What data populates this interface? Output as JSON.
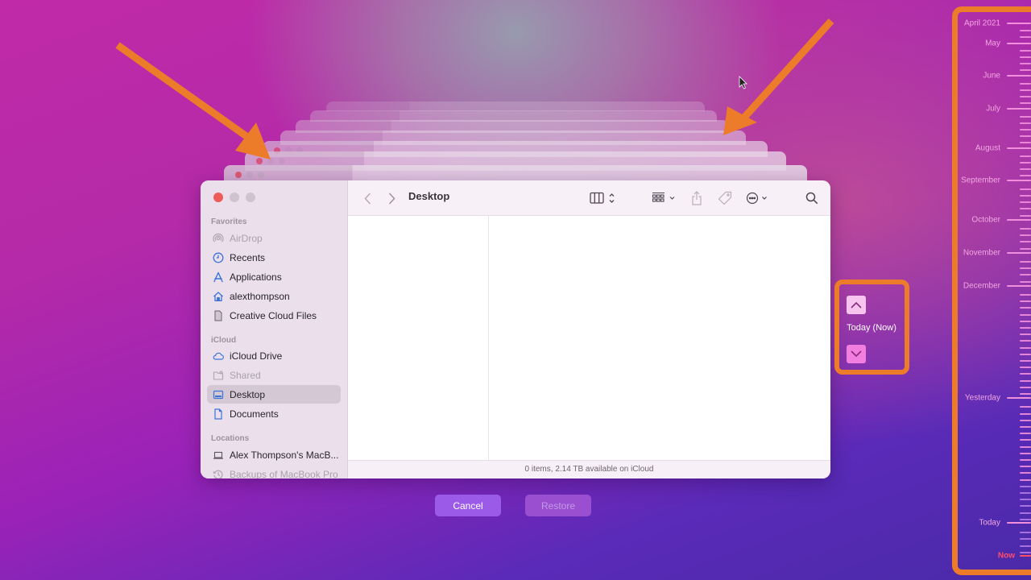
{
  "finder": {
    "title": "Desktop",
    "sidebar": {
      "sections": [
        {
          "label": "Favorites",
          "items": [
            {
              "label": "AirDrop",
              "icon": "airdrop-icon",
              "dim": true
            },
            {
              "label": "Recents",
              "icon": "clock-icon"
            },
            {
              "label": "Applications",
              "icon": "applications-icon"
            },
            {
              "label": "alexthompson",
              "icon": "home-icon"
            },
            {
              "label": "Creative Cloud Files",
              "icon": "document-icon"
            }
          ]
        },
        {
          "label": "iCloud",
          "items": [
            {
              "label": "iCloud Drive",
              "icon": "cloud-icon"
            },
            {
              "label": "Shared",
              "icon": "shared-folder-icon",
              "dim": true
            },
            {
              "label": "Desktop",
              "icon": "desktop-icon",
              "selected": true
            },
            {
              "label": "Documents",
              "icon": "document-icon"
            }
          ]
        },
        {
          "label": "Locations",
          "items": [
            {
              "label": "Alex Thompson's MacB...",
              "icon": "laptop-icon"
            },
            {
              "label": "Backups of MacBook Pro",
              "icon": "time-machine-icon",
              "dim": true
            }
          ]
        }
      ]
    },
    "toolbar": {
      "back": "back-icon",
      "forward": "forward-icon",
      "view": "column-view-icon",
      "group": "group-icon",
      "share": "share-icon",
      "tag": "tag-icon",
      "more": "more-icon",
      "search": "search-icon"
    },
    "status": "0 items, 2.14 TB available on iCloud"
  },
  "buttons": {
    "cancel": "Cancel",
    "restore": "Restore"
  },
  "navigator": {
    "label": "Today (Now)",
    "up": "chevron-up-icon",
    "down": "chevron-down-icon"
  },
  "timeline": {
    "labels": [
      "April 2021",
      "May",
      "June",
      "July",
      "August",
      "September",
      "October",
      "November",
      "December",
      "Yesterday",
      "Today",
      "Now"
    ]
  },
  "colors": {
    "annotation": "#ec7b2a",
    "now": "#ff4d6a",
    "tick": "#f28fdc"
  }
}
